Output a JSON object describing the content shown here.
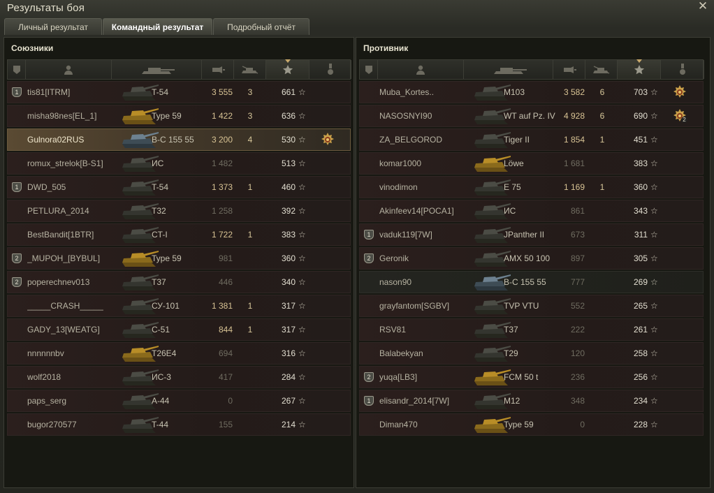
{
  "window": {
    "title": "Результаты боя",
    "close_label": "✕"
  },
  "tabs": [
    {
      "label": "Личный результат",
      "active": false
    },
    {
      "label": "Командный результат",
      "active": true
    },
    {
      "label": "Подробный отчёт",
      "active": false
    }
  ],
  "colors": {
    "background": "#1e1f1a",
    "self_row": "#5a4a33",
    "team_row": "#2b1f1d",
    "damage_highlight": "#d8c394"
  },
  "allies": {
    "title": "Союзники",
    "header_icons": [
      "platoon-icon",
      "player-icon",
      "tank-icon",
      "damage-icon",
      "kills-icon",
      "xp-star-icon",
      "medal-icon"
    ],
    "sorted_column": "xp",
    "players": [
      {
        "platoon": "1",
        "name": "tis81[ITRM]",
        "tank": "T-54",
        "tank_color": "grey",
        "damage": "3 555",
        "kills": "3",
        "xp": "661",
        "medal": "",
        "self": false
      },
      {
        "platoon": "",
        "name": "misha98nes[EL_1]",
        "tank": "Type 59",
        "tank_color": "gold",
        "damage": "1 422",
        "kills": "3",
        "xp": "636",
        "medal": "",
        "self": false
      },
      {
        "platoon": "",
        "name": "Gulnora02RUS",
        "tank": "В-С 155 55",
        "tank_color": "blue",
        "damage": "3 200",
        "kills": "4",
        "xp": "530",
        "medal": "order",
        "self": true
      },
      {
        "platoon": "",
        "name": "romux_strelok[B-S1]",
        "tank": "ИС",
        "tank_color": "grey",
        "damage": "1 482",
        "kills": "",
        "xp": "513",
        "medal": "",
        "self": false
      },
      {
        "platoon": "1",
        "name": "DWD_505",
        "tank": "T-54",
        "tank_color": "grey",
        "damage": "1 373",
        "kills": "1",
        "xp": "460",
        "medal": "",
        "self": false
      },
      {
        "platoon": "",
        "name": "PETLURA_2014",
        "tank": "T32",
        "tank_color": "grey",
        "damage": "1 258",
        "kills": "",
        "xp": "392",
        "medal": "",
        "self": false
      },
      {
        "platoon": "",
        "name": "BestBandit[1BTR]",
        "tank": "CT-I",
        "tank_color": "grey",
        "damage": "1 722",
        "kills": "1",
        "xp": "383",
        "medal": "",
        "self": false
      },
      {
        "platoon": "2",
        "name": "_MUPOH_[BYBUL]",
        "tank": "Type 59",
        "tank_color": "gold",
        "damage": "981",
        "kills": "",
        "xp": "360",
        "medal": "",
        "self": false
      },
      {
        "platoon": "2",
        "name": "poperechnev013",
        "tank": "T37",
        "tank_color": "grey",
        "damage": "446",
        "kills": "",
        "xp": "340",
        "medal": "",
        "self": false
      },
      {
        "platoon": "",
        "name": "_____CRASH_____",
        "tank": "СУ-101",
        "tank_color": "grey",
        "damage": "1 381",
        "kills": "1",
        "xp": "317",
        "medal": "",
        "self": false
      },
      {
        "platoon": "",
        "name": "GADY_13[WEATG]",
        "tank": "С-51",
        "tank_color": "grey",
        "damage": "844",
        "kills": "1",
        "xp": "317",
        "medal": "",
        "self": false
      },
      {
        "platoon": "",
        "name": "nnnnnnbv",
        "tank": "T26E4",
        "tank_color": "gold",
        "damage": "694",
        "kills": "",
        "xp": "316",
        "medal": "",
        "self": false
      },
      {
        "platoon": "",
        "name": "wolf2018",
        "tank": "ИС-3",
        "tank_color": "grey",
        "damage": "417",
        "kills": "",
        "xp": "284",
        "medal": "",
        "self": false
      },
      {
        "platoon": "",
        "name": "paps_serg",
        "tank": "A-44",
        "tank_color": "grey",
        "damage": "0",
        "kills": "",
        "xp": "267",
        "medal": "",
        "self": false
      },
      {
        "platoon": "",
        "name": "bugor270577",
        "tank": "T-44",
        "tank_color": "grey",
        "damage": "155",
        "kills": "",
        "xp": "214",
        "medal": "",
        "self": false
      }
    ]
  },
  "enemies": {
    "title": "Противник",
    "header_icons": [
      "platoon-icon",
      "player-icon",
      "tank-icon",
      "damage-icon",
      "kills-icon",
      "xp-star-icon",
      "medal-icon"
    ],
    "sorted_column": "xp",
    "players": [
      {
        "platoon": "",
        "name": "Muba_Kortes..",
        "tank": "M103",
        "tank_color": "grey",
        "damage": "3 582",
        "kills": "6",
        "xp": "703",
        "medal": "order",
        "medal_count": "",
        "plain": false
      },
      {
        "platoon": "",
        "name": "NASOSNYI90",
        "tank": "WT auf Pz. IV",
        "tank_color": "grey",
        "damage": "4 928",
        "kills": "6",
        "xp": "690",
        "medal": "order",
        "medal_count": "2",
        "plain": false
      },
      {
        "platoon": "",
        "name": "ZA_BELGOROD",
        "tank": "Tiger II",
        "tank_color": "grey",
        "damage": "1 854",
        "kills": "1",
        "xp": "451",
        "medal": "",
        "medal_count": "",
        "plain": false
      },
      {
        "platoon": "",
        "name": "komar1000",
        "tank": "Löwe",
        "tank_color": "gold",
        "damage": "1 681",
        "kills": "",
        "xp": "383",
        "medal": "",
        "medal_count": "",
        "plain": false
      },
      {
        "platoon": "",
        "name": "vinodimon",
        "tank": "E 75",
        "tank_color": "grey",
        "damage": "1 169",
        "kills": "1",
        "xp": "360",
        "medal": "",
        "medal_count": "",
        "plain": false
      },
      {
        "platoon": "",
        "name": "Akinfeev14[POCA1]",
        "tank": "ИС",
        "tank_color": "grey",
        "damage": "861",
        "kills": "",
        "xp": "343",
        "medal": "",
        "medal_count": "",
        "plain": false
      },
      {
        "platoon": "1",
        "name": "vaduk119[7W]",
        "tank": "JPanther II",
        "tank_color": "grey",
        "damage": "673",
        "kills": "",
        "xp": "311",
        "medal": "",
        "medal_count": "",
        "plain": false
      },
      {
        "platoon": "2",
        "name": "Geronik",
        "tank": "AMX 50 100",
        "tank_color": "grey",
        "damage": "897",
        "kills": "",
        "xp": "305",
        "medal": "",
        "medal_count": "",
        "plain": false
      },
      {
        "platoon": "",
        "name": "nason90",
        "tank": "В-С 155 55",
        "tank_color": "blue",
        "damage": "777",
        "kills": "",
        "xp": "269",
        "medal": "",
        "medal_count": "",
        "plain": true
      },
      {
        "platoon": "",
        "name": "grayfantom[SGBV]",
        "tank": "TVP VTU",
        "tank_color": "grey",
        "damage": "552",
        "kills": "",
        "xp": "265",
        "medal": "",
        "medal_count": "",
        "plain": false
      },
      {
        "platoon": "",
        "name": "RSV81",
        "tank": "T37",
        "tank_color": "grey",
        "damage": "222",
        "kills": "",
        "xp": "261",
        "medal": "",
        "medal_count": "",
        "plain": false
      },
      {
        "platoon": "",
        "name": "Balabekyan",
        "tank": "T29",
        "tank_color": "grey",
        "damage": "120",
        "kills": "",
        "xp": "258",
        "medal": "",
        "medal_count": "",
        "plain": false
      },
      {
        "platoon": "2",
        "name": "yuqa[LB3]",
        "tank": "FCM 50 t",
        "tank_color": "gold",
        "damage": "236",
        "kills": "",
        "xp": "256",
        "medal": "",
        "medal_count": "",
        "plain": false
      },
      {
        "platoon": "1",
        "name": "elisandr_2014[7W]",
        "tank": "M12",
        "tank_color": "grey",
        "damage": "348",
        "kills": "",
        "xp": "234",
        "medal": "",
        "medal_count": "",
        "plain": false
      },
      {
        "platoon": "",
        "name": "Diman470",
        "tank": "Type 59",
        "tank_color": "gold",
        "damage": "0",
        "kills": "",
        "xp": "228",
        "medal": "",
        "medal_count": "",
        "plain": false
      }
    ]
  }
}
